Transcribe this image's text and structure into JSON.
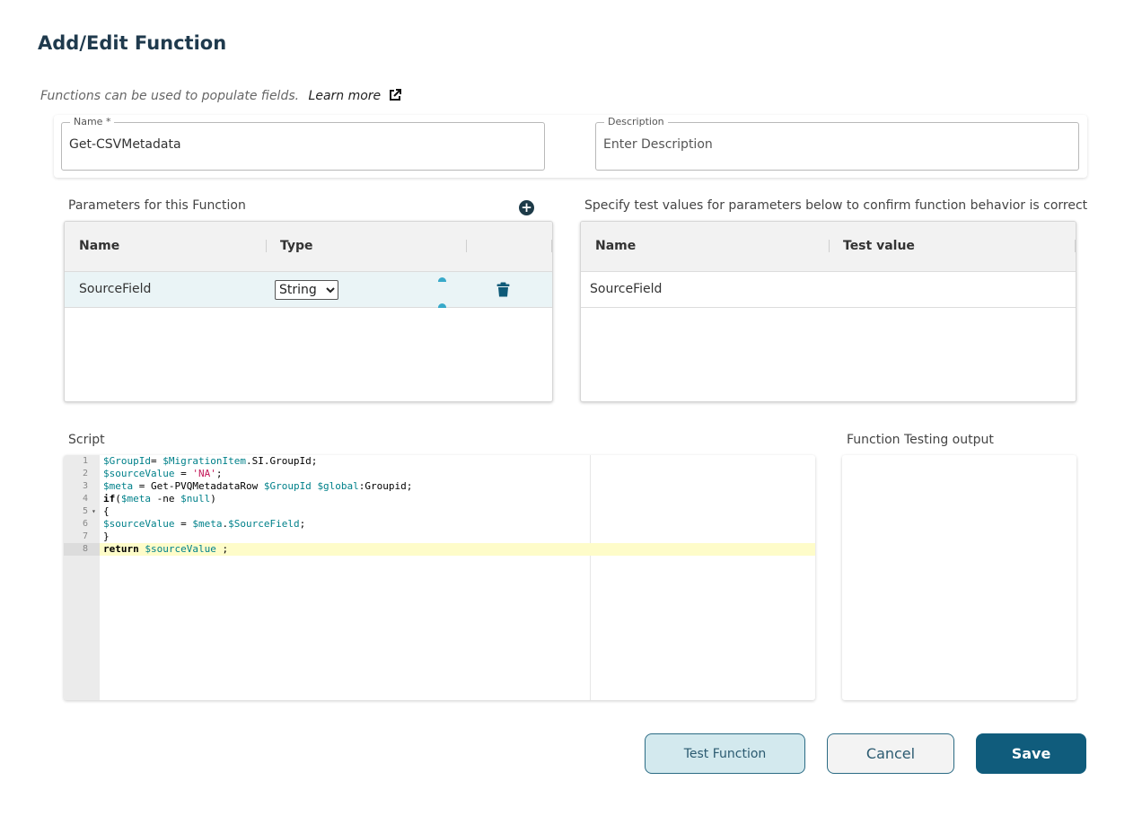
{
  "page": {
    "title": "Add/Edit Function"
  },
  "intro": {
    "text": "Functions can be used to populate fields.",
    "learn_more": "Learn more"
  },
  "fields": {
    "name_label": "Name *",
    "name_value": "Get-CSVMetadata",
    "description_label": "Description",
    "description_placeholder": "Enter Description"
  },
  "parameters": {
    "title": "Parameters for this Function",
    "columns": [
      "Name",
      "Type"
    ],
    "rows": [
      {
        "name": "SourceField",
        "type": "String"
      }
    ],
    "type_options": [
      "String"
    ]
  },
  "test_values": {
    "title": "Specify test values for parameters below to confirm function behavior is correct",
    "columns": [
      "Name",
      "Test value"
    ],
    "rows": [
      {
        "name": "SourceField",
        "value": ""
      }
    ]
  },
  "script": {
    "title": "Script",
    "line_numbers": [
      "1",
      "2",
      "3",
      "4",
      "5",
      "6",
      "7",
      "8"
    ],
    "active_line": 8,
    "lines": [
      "$GroupId= $MigrationItem.SI.GroupId;",
      "$sourceValue = 'NA';",
      "$meta = Get-PVQMetadataRow $GroupId $global:Groupid;",
      "if($meta -ne $null)",
      "{",
      "$sourceValue = $meta.$SourceField;",
      "}",
      "return $sourceValue ;"
    ]
  },
  "output": {
    "title": "Function Testing output"
  },
  "buttons": {
    "test": "Test Function",
    "cancel": "Cancel",
    "save": "Save"
  },
  "colors": {
    "primary": "#105c7c",
    "accent": "#38a9c9",
    "selected_row": "#eaf4f6",
    "active_line": "#fefcc9"
  }
}
